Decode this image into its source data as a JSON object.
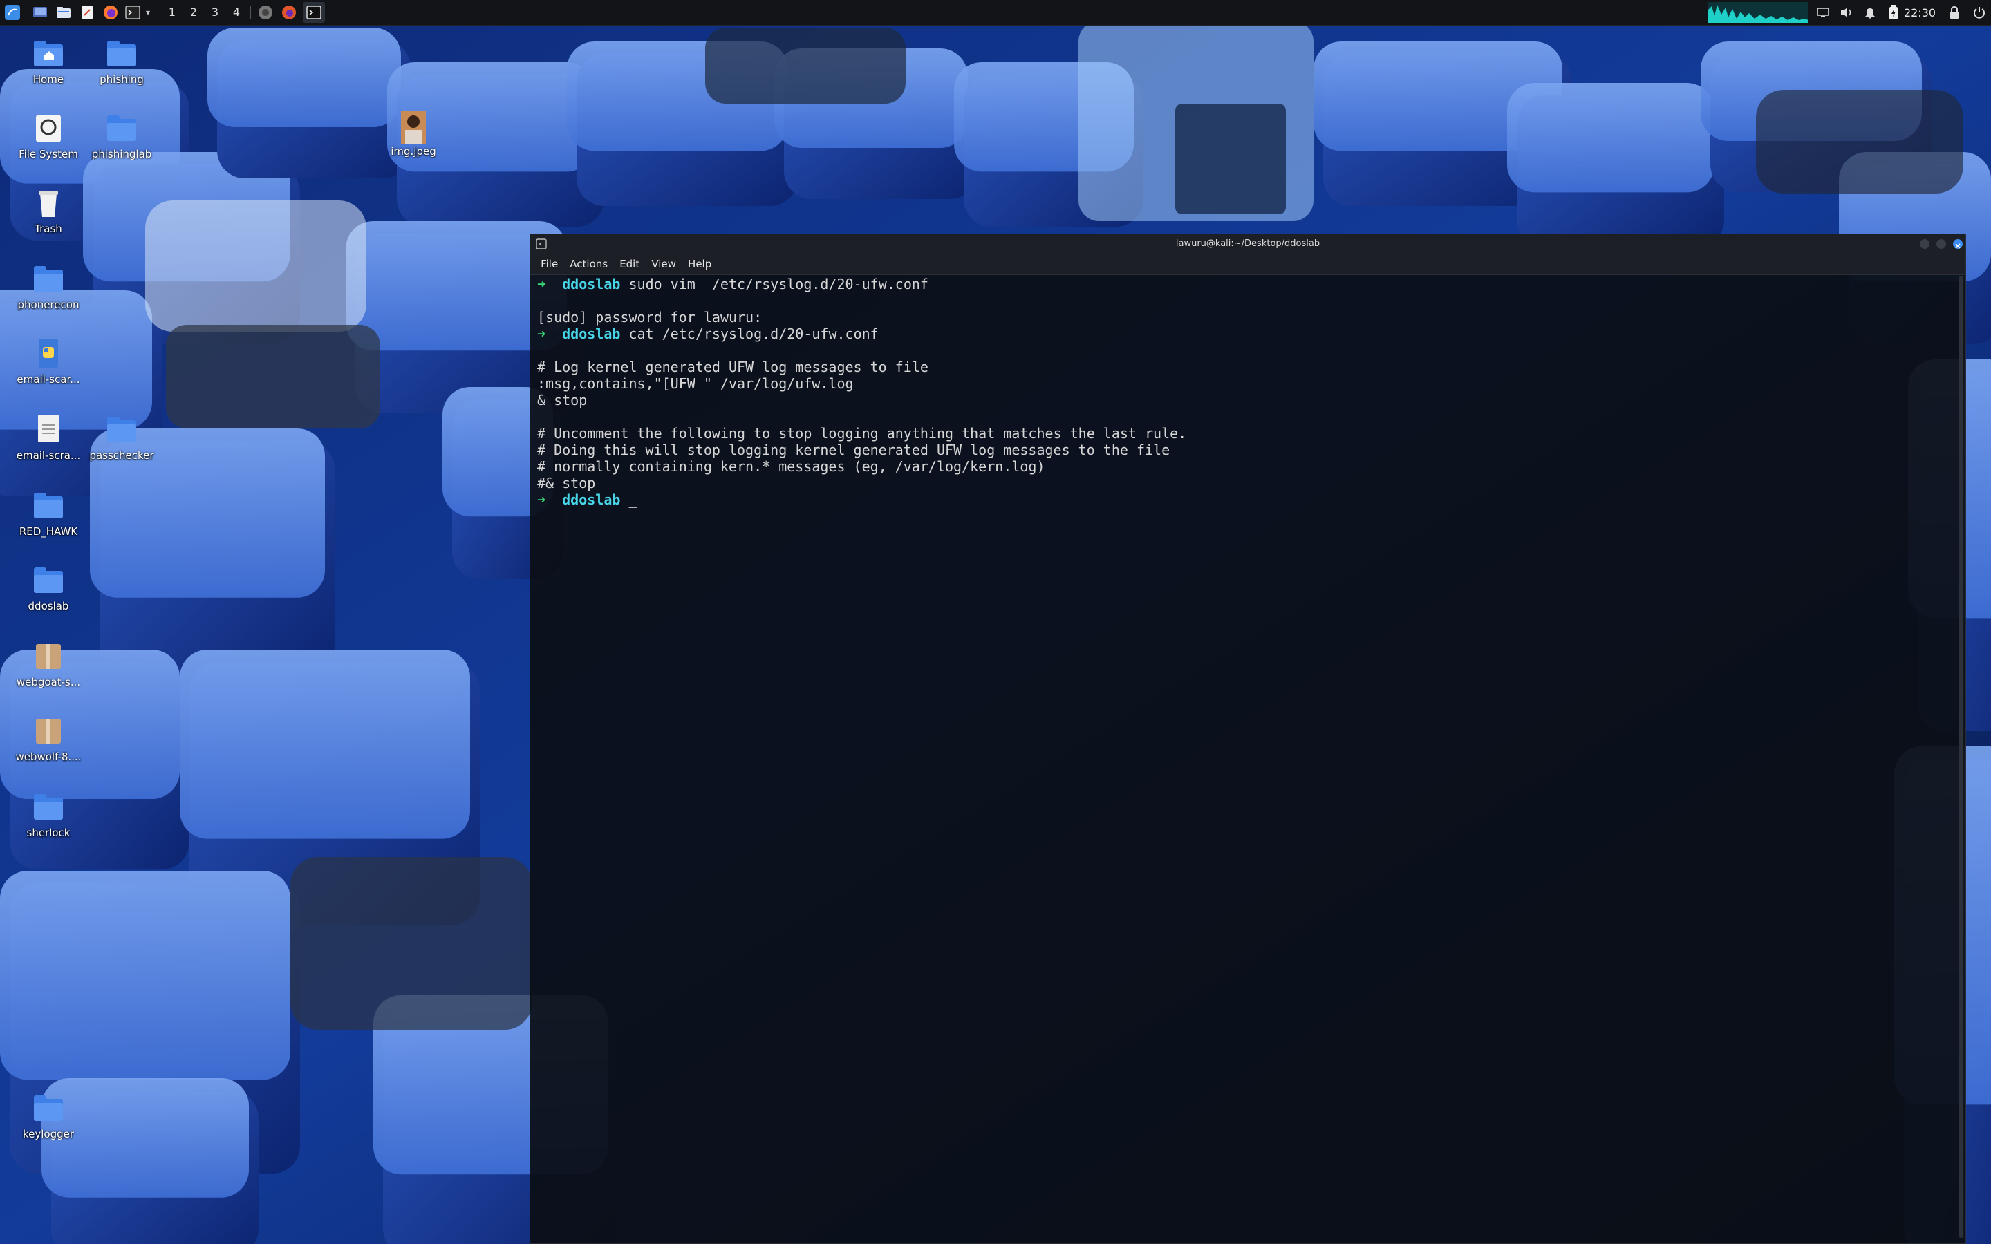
{
  "panel": {
    "workspaces": [
      "1",
      "2",
      "3",
      "4"
    ],
    "clock": "22:30",
    "launcher_icons": [
      "kali-menu-icon",
      "desktop-icon",
      "file-manager-icon",
      "text-editor-icon",
      "firefox-icon",
      "terminal-icon"
    ],
    "tray_icons": [
      "cpu-graph",
      "display-icon",
      "volume-icon",
      "notification-bell-icon",
      "battery-icon",
      "lock-icon",
      "power-icon"
    ]
  },
  "desktop": {
    "icons": [
      {
        "label": "Home",
        "type": "home"
      },
      {
        "label": "phishing",
        "type": "folder"
      },
      {
        "label": "File System",
        "type": "drive"
      },
      {
        "label": "phishinglab",
        "type": "folder"
      },
      {
        "label": "img.jpeg",
        "type": "image"
      },
      {
        "label": "Trash",
        "type": "trash"
      },
      {
        "label": "phonerecon",
        "type": "folder"
      },
      {
        "label": "email-scar...",
        "type": "python"
      },
      {
        "label": "email-scra...",
        "type": "text"
      },
      {
        "label": "passchecker",
        "type": "folder"
      },
      {
        "label": "RED_HAWK",
        "type": "folder"
      },
      {
        "label": "ddoslab",
        "type": "folder"
      },
      {
        "label": "webgoat-s...",
        "type": "package"
      },
      {
        "label": "webwolf-8....",
        "type": "package"
      },
      {
        "label": "sherlock",
        "type": "folder"
      },
      {
        "label": "keylogger",
        "type": "folder"
      }
    ]
  },
  "terminal": {
    "title": "lawuru@kali:~/Desktop/ddoslab",
    "menu": [
      "File",
      "Actions",
      "Edit",
      "View",
      "Help"
    ],
    "prompt_dir": "ddoslab",
    "prompt_arrow": "➜",
    "lines": {
      "cmd1": "sudo vim  /etc/rsyslog.d/20-ufw.conf",
      "sudo": "[sudo] password for lawuru:",
      "cmd2": "cat /etc/rsyslog.d/20-ufw.conf",
      "out1": "# Log kernel generated UFW log messages to file",
      "out2": ":msg,contains,\"[UFW \" /var/log/ufw.log",
      "out3": "& stop",
      "out4": "# Uncomment the following to stop logging anything that matches the last rule.",
      "out5": "# Doing this will stop logging kernel generated UFW log messages to the file",
      "out6": "# normally containing kern.* messages (eg, /var/log/kern.log)",
      "out7": "#& stop",
      "cursor": "_"
    }
  },
  "colors": {
    "prompt_arrow": "#3ddc7a",
    "prompt_dir": "#48d6e8",
    "terminal_bg": "#0b0e14",
    "panel_bg": "#121418",
    "folder": "#3f7fe8"
  }
}
